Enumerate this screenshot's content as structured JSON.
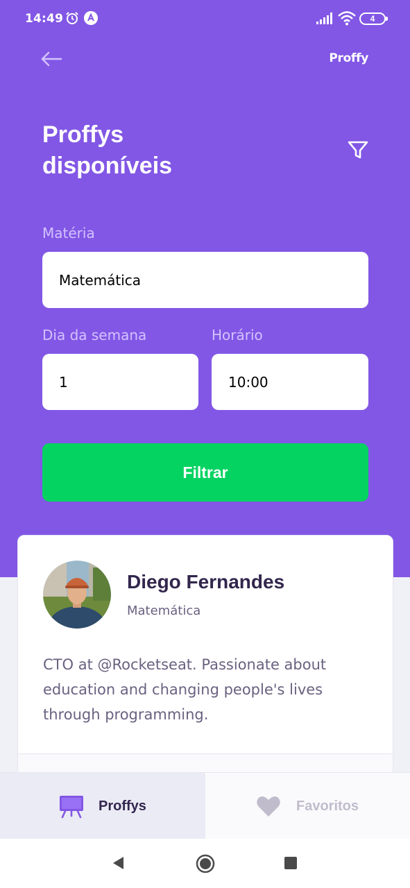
{
  "status_bar": {
    "time": "14:49",
    "battery": "4",
    "icons": [
      "alarm-icon",
      "app-notification-icon",
      "signal-icon",
      "wifi-icon",
      "battery-icon"
    ]
  },
  "header": {
    "brand": "Proffy",
    "title_line1": "Proffys",
    "title_line2": "disponíveis",
    "icons": [
      "back-arrow-icon",
      "filter-icon"
    ]
  },
  "filters": {
    "subject_label": "Matéria",
    "subject_value": "Matemática",
    "weekday_label": "Dia da semana",
    "weekday_value": "1",
    "time_label": "Horário",
    "time_value": "10:00",
    "submit_label": "Filtrar"
  },
  "teachers": [
    {
      "name": "Diego Fernandes",
      "subject": "Matemática",
      "bio": "CTO at @Rocketseat. Passionate about education and changing people's lives through programming."
    }
  ],
  "tabs": [
    {
      "label": "Proffys",
      "icon": "easel-icon",
      "active": true
    },
    {
      "label": "Favoritos",
      "icon": "heart-icon",
      "active": false
    }
  ],
  "nav_bar": {
    "icons": [
      "nav-back-icon",
      "nav-home-icon",
      "nav-recents-icon"
    ]
  },
  "colors": {
    "primary": "#8257E5",
    "secondary": "#04D361",
    "label": "#D4C2FF",
    "title_dark": "#32264D",
    "text_body": "#6A6180",
    "background": "#F0F0F7"
  }
}
